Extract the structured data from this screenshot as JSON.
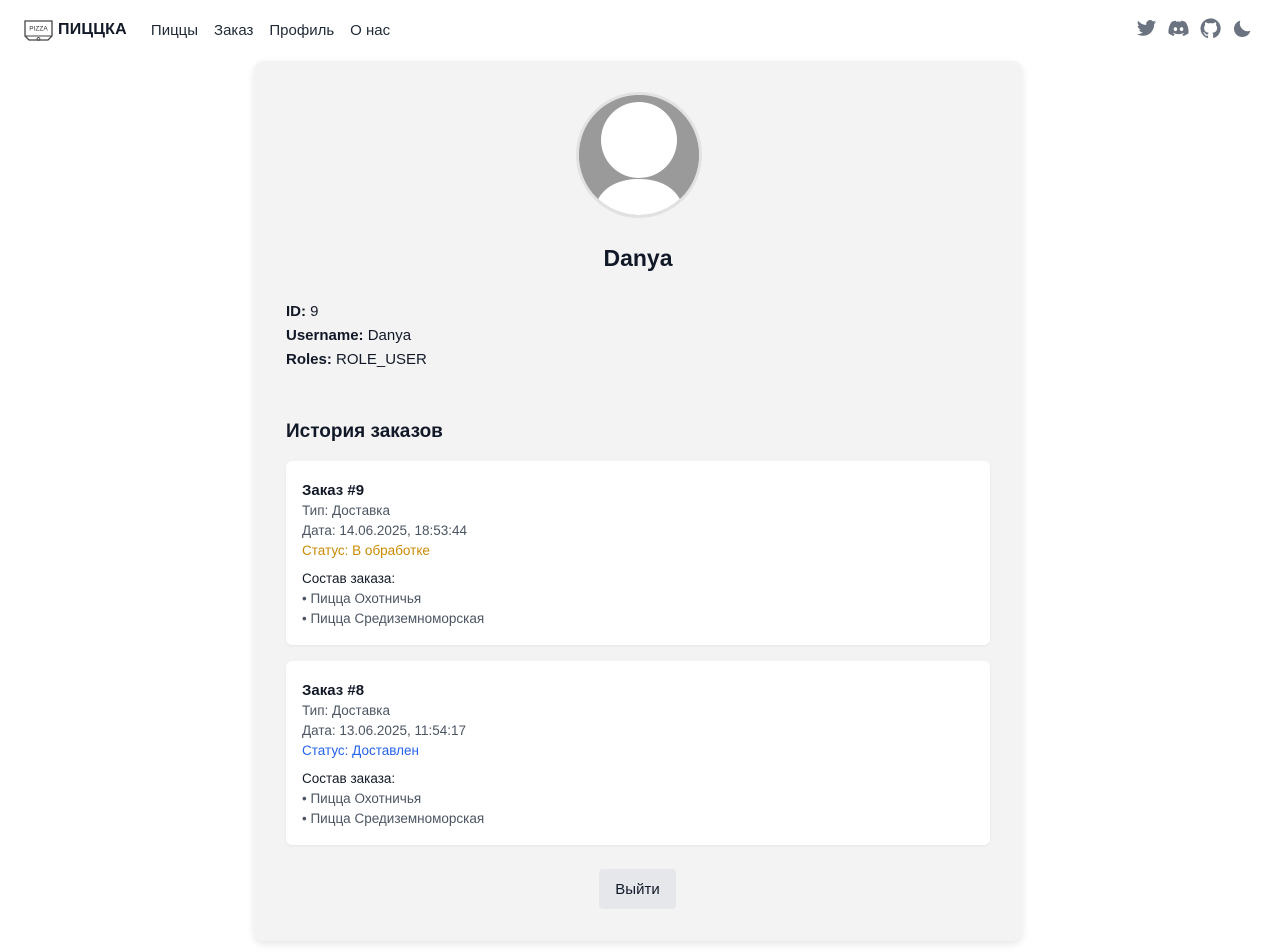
{
  "brand": {
    "name": "ПИЦЦКА",
    "logo_text": "PIZZA",
    "logo_icon": "pizza-box-icon"
  },
  "nav": {
    "links": [
      "Пиццы",
      "Заказ",
      "Профиль",
      "О нас"
    ]
  },
  "social_icons": [
    "twitter-icon",
    "discord-icon",
    "github-icon",
    "moon-icon"
  ],
  "profile": {
    "display_name": "Danya",
    "avatar_icon": "user-avatar-icon",
    "id_label": "ID:",
    "id_value": "9",
    "username_label": "Username:",
    "username_value": "Danya",
    "roles_label": "Roles:",
    "roles_value": "ROLE_USER"
  },
  "history": {
    "title": "История заказов",
    "orders": [
      {
        "title": "Заказ #9",
        "type": "Тип: Доставка",
        "date": "Дата: 14.06.2025, 18:53:44",
        "status": "Статус: В обработке",
        "items_label": "Состав заказа:",
        "items": [
          "• Пицца Охотничья",
          "• Пицца Средиземноморская"
        ]
      },
      {
        "title": "Заказ #8",
        "type": "Тип: Доставка",
        "date": "Дата: 13.06.2025, 11:54:17",
        "status": "Статус: Доставлен",
        "items_label": "Состав заказа:",
        "items": [
          "• Пицца Охотничья",
          "• Пицца Средиземноморская"
        ]
      }
    ]
  },
  "logout_label": "Выйти",
  "colors": {
    "status_processing": "#ca8a04",
    "status_delivered": "#2563eb",
    "card_bg": "#f3f3f3"
  }
}
